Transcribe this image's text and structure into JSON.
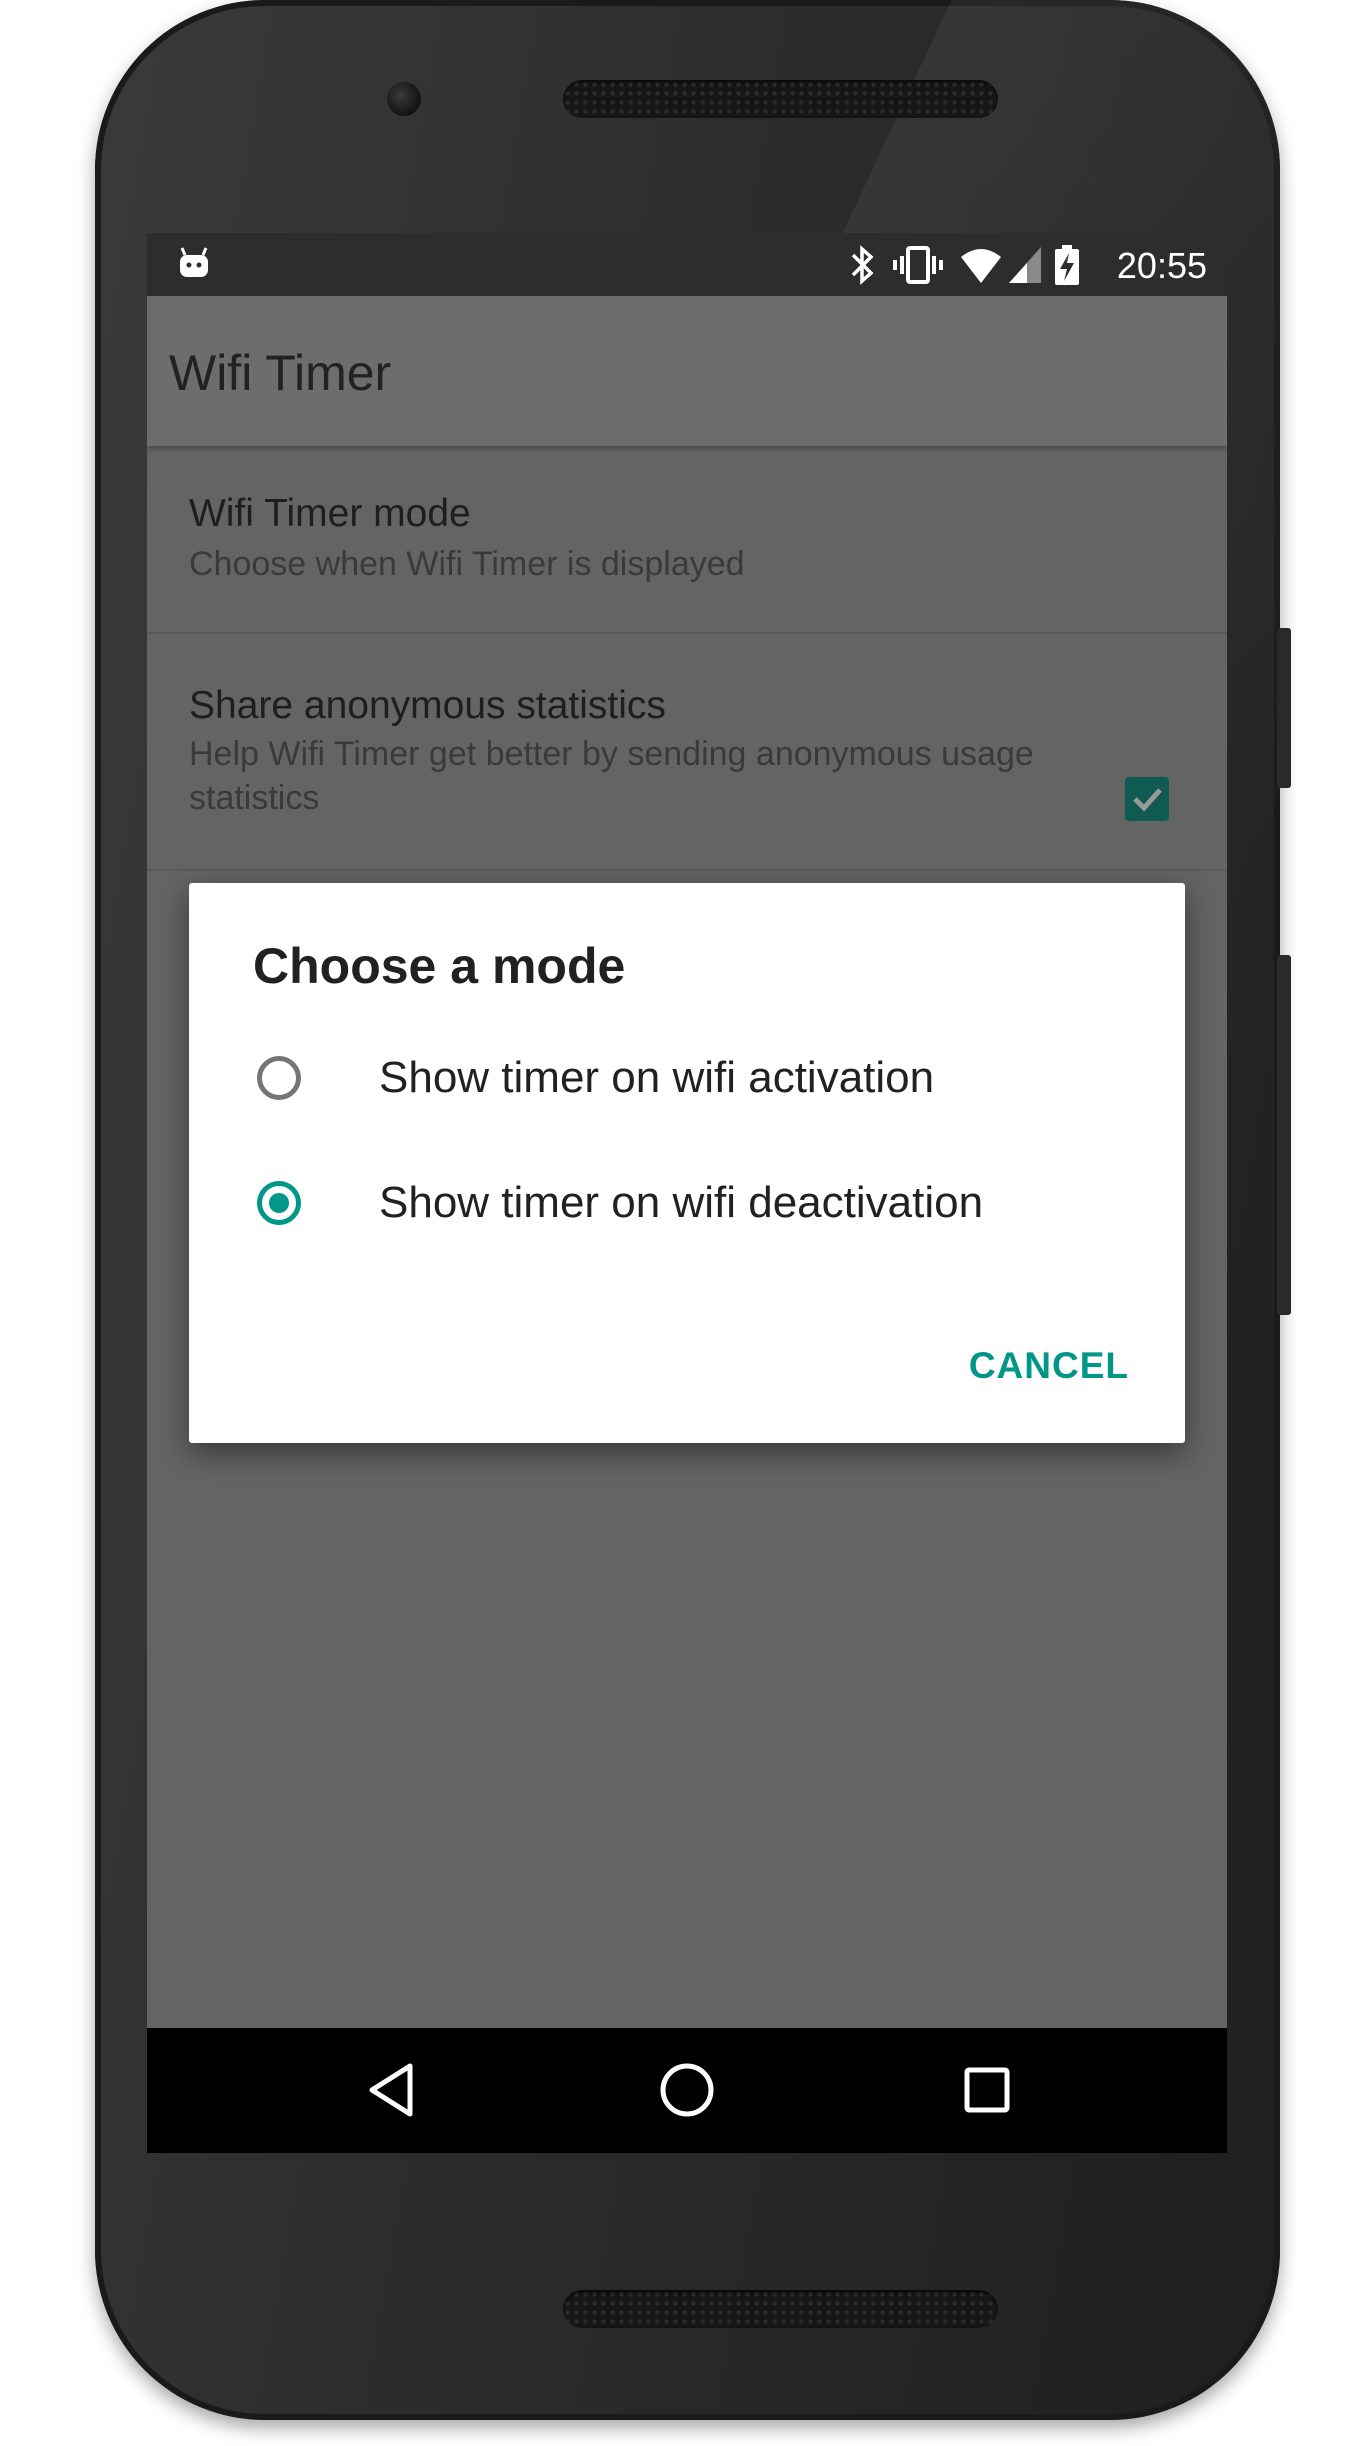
{
  "status_bar": {
    "time": "20:55",
    "icons": [
      "android-notification-icon",
      "bluetooth-icon",
      "vibrate-icon",
      "wifi-icon",
      "cell-signal-icon",
      "battery-charging-icon"
    ]
  },
  "app_bar": {
    "title": "Wifi Timer"
  },
  "preferences": [
    {
      "title": "Wifi Timer mode",
      "summary": "Choose when Wifi Timer is displayed"
    },
    {
      "title": "Share anonymous statistics",
      "summary": "Help Wifi Timer get better by sending anonymous usage statistics",
      "checked": true
    }
  ],
  "dialog": {
    "title": "Choose a mode",
    "options": [
      {
        "label": "Show timer on wifi activation",
        "selected": false
      },
      {
        "label": "Show timer on wifi deactivation",
        "selected": true
      }
    ],
    "cancel_label": "CANCEL"
  },
  "nav_bar": {
    "icons": [
      "back-icon",
      "home-icon",
      "recents-icon"
    ]
  },
  "colors": {
    "accent": "#009688",
    "checkbox": "#0f5a52",
    "scrim_background": "#646464"
  }
}
